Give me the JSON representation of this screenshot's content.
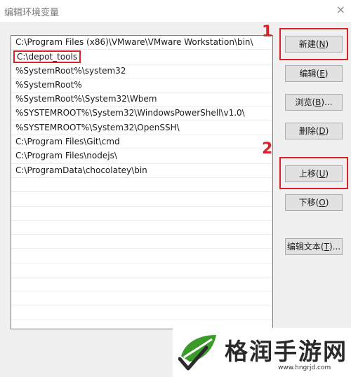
{
  "window": {
    "title": "编辑环境变量",
    "close_glyph": "×"
  },
  "path_list": {
    "items": [
      "C:\\Program Files (x86)\\VMware\\VMware Workstation\\bin\\",
      "C:\\depot_tools",
      "%SystemRoot%\\system32",
      "%SystemRoot%",
      "%SystemRoot%\\System32\\Wbem",
      "%SYSTEMROOT%\\System32\\WindowsPowerShell\\v1.0\\",
      "%SYSTEMROOT%\\System32\\OpenSSH\\",
      "C:\\Program Files\\Git\\cmd",
      "C:\\Program Files\\nodejs\\",
      "C:\\ProgramData\\chocolatey\\bin"
    ],
    "highlighted_index": 1
  },
  "buttons": {
    "new": {
      "label": "新建(",
      "key": "N",
      "tail": ")"
    },
    "edit": {
      "label": "编辑(",
      "key": "E",
      "tail": ")"
    },
    "browse": {
      "label": "浏览(",
      "key": "B",
      "tail": ")..."
    },
    "delete": {
      "label": "删除(",
      "key": "D",
      "tail": ")"
    },
    "move_up": {
      "label": "上移(",
      "key": "U",
      "tail": ")"
    },
    "move_down": {
      "label": "下移(",
      "key": "O",
      "tail": ")"
    },
    "edit_text": {
      "label": "编辑文本(",
      "key": "T",
      "tail": ")..."
    }
  },
  "annotations": {
    "step1": "1",
    "step2": "2"
  },
  "watermark": {
    "text": "格润手游网",
    "url": "www.hngrjd.com"
  },
  "colors": {
    "highlight": "#d8232a",
    "watermark_green": "#2e8b2e"
  }
}
